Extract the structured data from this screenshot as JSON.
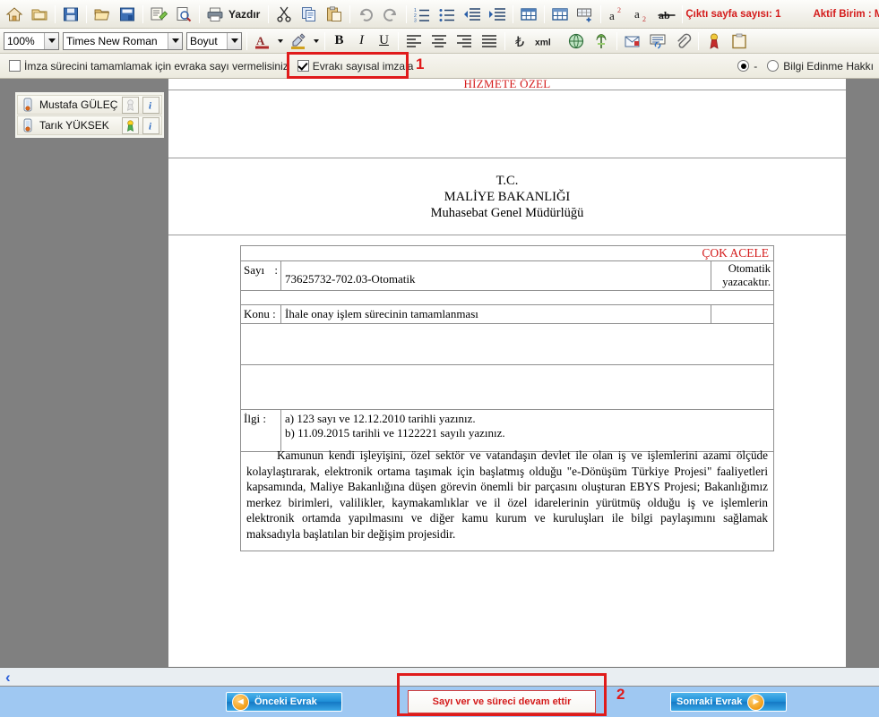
{
  "toolbar_row1": {
    "icons": [
      {
        "name": "home-icon",
        "title": "Ana Sayfa"
      },
      {
        "name": "new-document-icon",
        "title": "Yeni"
      },
      {
        "name": "save-icon",
        "title": "Kaydet"
      },
      {
        "name": "open-folder-icon",
        "title": "Aç"
      },
      {
        "name": "save-as-icon",
        "title": "Farklı Kaydet"
      },
      {
        "name": "properties-icon",
        "title": "Özellikler"
      },
      {
        "name": "print-preview-icon",
        "title": "Baskı Önizleme"
      }
    ],
    "print_label": "Yazdır",
    "clipboard_icons": [
      {
        "name": "cut-icon",
        "title": "Kes"
      },
      {
        "name": "copy-icon",
        "title": "Kopyala"
      },
      {
        "name": "paste-icon",
        "title": "Yapıştır"
      }
    ],
    "history_icons": [
      {
        "name": "undo-icon",
        "title": "Geri Al"
      },
      {
        "name": "redo-icon",
        "title": "Yinele"
      }
    ],
    "list_icons": [
      {
        "name": "numbered-list-icon",
        "title": "Numaralı Liste"
      },
      {
        "name": "bullet-list-icon",
        "title": "Madde İşaretli Liste"
      },
      {
        "name": "decrease-indent-icon",
        "title": "Girintiyi Azalt"
      },
      {
        "name": "increase-indent-icon",
        "title": "Girintiyi Artır"
      }
    ],
    "table_icons": [
      {
        "name": "insert-table-icon",
        "title": "Tablo Ekle"
      },
      {
        "name": "table-properties-icon",
        "title": "Tablo Özellikleri"
      },
      {
        "name": "insert-row-icon",
        "title": "Satır Ekle"
      }
    ],
    "script_icons": [
      {
        "name": "superscript-icon",
        "label": "a2"
      },
      {
        "name": "subscript-icon",
        "label": "a2"
      },
      {
        "name": "strikethrough-icon",
        "label": "ab"
      }
    ],
    "page_count_label": "Çıktı sayfa sayısı: 1",
    "active_unit_label": "Aktif Birim : M"
  },
  "toolbar_row2": {
    "zoom_value": "100%",
    "font_value": "Times New Roman",
    "size_value": "Boyut",
    "font_color_icon": "font-color-icon",
    "highlight_icon": "highlight-color-icon",
    "bold_label": "B",
    "italic_label": "I",
    "underline_label": "U",
    "align_icons": [
      {
        "name": "align-left-icon"
      },
      {
        "name": "align-center-icon"
      },
      {
        "name": "align-right-icon"
      },
      {
        "name": "align-justify-icon"
      }
    ],
    "extra_icons": [
      {
        "name": "turkish-lira-icon",
        "label": "₺"
      },
      {
        "name": "xml-icon",
        "label": "xml"
      },
      {
        "name": "globe-icon"
      },
      {
        "name": "tree-view-icon"
      },
      {
        "name": "mail-merge-icon"
      },
      {
        "name": "hyperlink-icon"
      },
      {
        "name": "attachment-icon"
      },
      {
        "name": "signature-seal-icon"
      },
      {
        "name": "clipboard-icon"
      }
    ]
  },
  "toolbar_row3": {
    "left_checkbox": {
      "label": "İmza sürecini tamamlamak için evraka sayı vermelisiniz",
      "checked": false
    },
    "digital_sign_checkbox": {
      "label": "Evrakı sayısal imzala",
      "checked": true
    },
    "radio_dash": {
      "label": "-",
      "selected": true
    },
    "radio_info": {
      "label": "Bilgi Edinme Hakkı",
      "selected": false
    }
  },
  "annotations": [
    {
      "number": "1",
      "target": "digital-sign-checkbox"
    },
    {
      "number": "2",
      "target": "sayi-ver-button"
    }
  ],
  "signer_panel": {
    "rows": [
      {
        "name": "Mustafa GÜLEÇ",
        "status_icon": "pending-seal-icon",
        "info_icon": "info-icon",
        "user_icon": "user-signature-icon"
      },
      {
        "name": "Tarık YÜKSEK",
        "status_icon": "approved-seal-icon",
        "info_icon": "info-icon",
        "user_icon": "user-signature-icon"
      }
    ]
  },
  "document": {
    "classification": "HİZMETE ÖZEL",
    "header_lines": [
      "T.C.",
      "MALİYE BAKANLIĞI",
      "Muhasebat Genel Müdürlüğü"
    ],
    "urgency": "ÇOK ACELE",
    "fields": [
      {
        "label": "Sayı",
        "separator": ":",
        "value": "73625732-702.03-Otomatik",
        "right_note": "Otomatik yazacaktır."
      },
      {
        "label": "Konu",
        "separator": ":",
        "value": "İhale onay işlem sürecinin tamamlanması",
        "right_note": ""
      }
    ],
    "ilgi": {
      "label": "İlgi",
      "separator": ":",
      "items": [
        "a) 123 sayı ve 12.12.2010 tarihli yazınız.",
        "b) 11.09.2015 tarihli ve 1122221 sayılı yazınız."
      ]
    },
    "body_paragraph": "Kamunun kendi işleyişini, özel sektör ve vatandaşın devlet ile olan iş ve işlemlerini azami ölçüde kolaylaştırarak, elektronik ortama taşımak için başlatmış olduğu \"e-Dönüşüm Türkiye Projesi\" faaliyetleri kapsamında, Maliye Bakanlığına düşen görevin önemli bir parçasını oluşturan EBYS Projesi; Bakanlığımız merkez birimleri, valilikler, kaymakamlıklar ve il özel idarelerinin yürütmüş olduğu iş ve işlemlerin elektronik ortamda yapılmasını ve diğer kamu kurum ve kuruluşları ile bilgi paylaşımını sağlamak maksadıyla başlatılan bir değişim projesidir."
  },
  "scrollbar": {
    "left_chevron": "‹"
  },
  "actionbar": {
    "prev_button": {
      "label": "Önceki Evrak",
      "icon": "arrow-left-circle-icon",
      "arrow": "◄"
    },
    "primary_button": {
      "label": "Sayı ver ve süreci devam ettir"
    },
    "next_button": {
      "label": "Sonraki Evrak",
      "icon": "arrow-right-circle-icon",
      "arrow": "►"
    }
  },
  "colors": {
    "accent_red": "#d41b1b",
    "annotation_red": "#e01b1b",
    "workspace_gray": "#808080",
    "actionbar_blue": "#9fc8f2",
    "button_blue": "#1f8fd8"
  }
}
